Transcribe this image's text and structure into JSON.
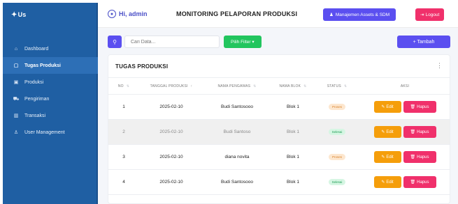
{
  "sidebar": {
    "logo_text": "Us",
    "items": [
      {
        "icon": "home-icon",
        "glyph": "⌂",
        "label": "Dashboard"
      },
      {
        "icon": "clipboard-icon",
        "glyph": "▢",
        "label": "Tugas Produksi"
      },
      {
        "icon": "box-icon",
        "glyph": "▣",
        "label": "Produksi"
      },
      {
        "icon": "truck-icon",
        "glyph": "⛟",
        "label": "Pengiriman"
      },
      {
        "icon": "transaction-icon",
        "glyph": "▥",
        "label": "Transaksi"
      },
      {
        "icon": "users-icon",
        "glyph": "♙",
        "label": "User Management"
      }
    ],
    "active_index": 1
  },
  "header": {
    "greeting": "Hi, admin",
    "title": "MONITORING PELAPORAN PRODUKSI",
    "assets_button": "Manajemen Assets & SDM",
    "logout_button": "Logout"
  },
  "toolbar": {
    "search_placeholder": "Cari Data...",
    "filter_button": "Pilih Filter ▾",
    "add_button": "+ Tambah"
  },
  "table": {
    "title": "TUGAS PRODUKSI",
    "columns": [
      "NO",
      "TANGGAL PRODUKSI",
      "NAMA PENGAWAS",
      "NAMA BLOK",
      "STATUS",
      "AKSI"
    ],
    "rows": [
      {
        "no": "1",
        "date": "2025-02-10",
        "supervisor": "Budi Santosooo",
        "block": "Blok 1",
        "status": "Proses",
        "status_type": "proses"
      },
      {
        "no": "2",
        "date": "2025-02-10",
        "supervisor": "Budi Santoso",
        "block": "Blok 1",
        "status": "Selesai",
        "status_type": "selesai"
      },
      {
        "no": "3",
        "date": "2025-02-10",
        "supervisor": "diana novita",
        "block": "Blok 1",
        "status": "Proses",
        "status_type": "proses"
      },
      {
        "no": "4",
        "date": "2025-02-10",
        "supervisor": "Budi Santosooo",
        "block": "Blok 1",
        "status": "Selesai",
        "status_type": "selesai"
      }
    ],
    "edit_label": "Edit",
    "delete_label": "Hapus"
  },
  "colors": {
    "sidebar_bg": "#1f5fa3",
    "primary": "#5b4ff0",
    "danger": "#f0306b",
    "warning": "#f59e0b",
    "success": "#22c55e"
  }
}
